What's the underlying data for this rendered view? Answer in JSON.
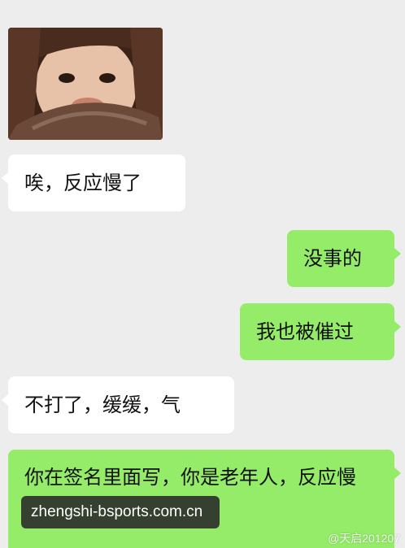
{
  "photo": {
    "icon": "girl-sticker-photo",
    "colors": [
      "#3a2418",
      "#e8c2a8",
      "#c8826c",
      "#6b4a3a"
    ]
  },
  "messages": [
    {
      "side": "in",
      "text": "唉，反应慢了"
    },
    {
      "side": "out",
      "text": "没事的"
    },
    {
      "side": "out",
      "text": "我也被催过"
    },
    {
      "side": "in",
      "text": "不打了，缓缓，气"
    },
    {
      "side": "out",
      "text": "你在签名里面写，你是老年人，反应慢"
    }
  ],
  "overlay": {
    "site": "zhengshi-bsports.com.cn",
    "weibo": "@天启201207"
  },
  "colors": {
    "background": "#ededed",
    "incoming": "#ffffff",
    "outgoing": "#95ec69"
  }
}
